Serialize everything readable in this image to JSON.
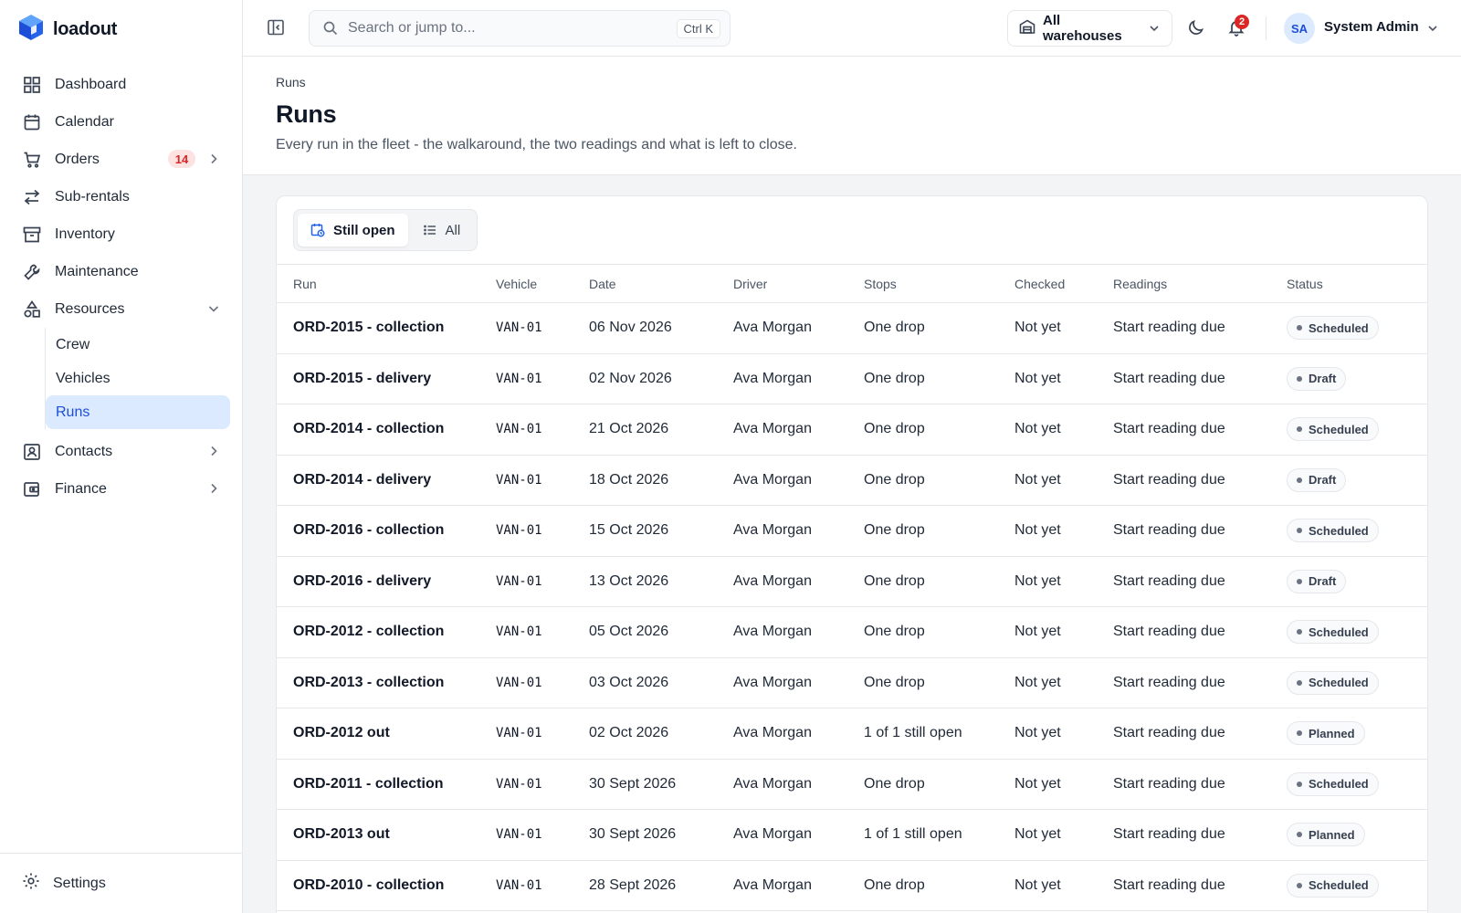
{
  "brand": {
    "name": "loadout"
  },
  "sidebar": {
    "items": [
      {
        "label": "Dashboard",
        "icon": "grid-icon"
      },
      {
        "label": "Calendar",
        "icon": "calendar-icon"
      },
      {
        "label": "Orders",
        "icon": "cart-icon",
        "badge": "14"
      },
      {
        "label": "Sub-rentals",
        "icon": "swap-icon"
      },
      {
        "label": "Inventory",
        "icon": "archive-icon"
      },
      {
        "label": "Maintenance",
        "icon": "wrench-icon"
      },
      {
        "label": "Resources",
        "icon": "shapes-icon"
      },
      {
        "label": "Contacts",
        "icon": "contact-card-icon"
      },
      {
        "label": "Finance",
        "icon": "wallet-icon"
      }
    ],
    "resources_sub": [
      "Crew",
      "Vehicles",
      "Runs"
    ],
    "active_sub": "Runs",
    "settings_label": "Settings"
  },
  "topbar": {
    "search_placeholder": "Search or jump to...",
    "shortcut": "Ctrl K",
    "warehouse": "All warehouses",
    "notifications": "2",
    "avatar_initials": "SA",
    "user_name": "System Admin"
  },
  "page": {
    "breadcrumb": "Runs",
    "title": "Runs",
    "subtitle": "Every run in the fleet - the walkaround, the two readings and what is left to close."
  },
  "filters": {
    "still_open": "Still open",
    "all": "All",
    "selected": "Still open"
  },
  "table": {
    "columns": [
      "Run",
      "Vehicle",
      "Date",
      "Driver",
      "Stops",
      "Checked",
      "Readings",
      "Status"
    ],
    "rows": [
      [
        "ORD-2015 - collection",
        "VAN-01",
        "06 Nov 2026",
        "Ava Morgan",
        "One drop",
        "Not yet",
        "Start reading due",
        "Scheduled"
      ],
      [
        "ORD-2015 - delivery",
        "VAN-01",
        "02 Nov 2026",
        "Ava Morgan",
        "One drop",
        "Not yet",
        "Start reading due",
        "Draft"
      ],
      [
        "ORD-2014 - collection",
        "VAN-01",
        "21 Oct 2026",
        "Ava Morgan",
        "One drop",
        "Not yet",
        "Start reading due",
        "Scheduled"
      ],
      [
        "ORD-2014 - delivery",
        "VAN-01",
        "18 Oct 2026",
        "Ava Morgan",
        "One drop",
        "Not yet",
        "Start reading due",
        "Draft"
      ],
      [
        "ORD-2016 - collection",
        "VAN-01",
        "15 Oct 2026",
        "Ava Morgan",
        "One drop",
        "Not yet",
        "Start reading due",
        "Scheduled"
      ],
      [
        "ORD-2016 - delivery",
        "VAN-01",
        "13 Oct 2026",
        "Ava Morgan",
        "One drop",
        "Not yet",
        "Start reading due",
        "Draft"
      ],
      [
        "ORD-2012 - collection",
        "VAN-01",
        "05 Oct 2026",
        "Ava Morgan",
        "One drop",
        "Not yet",
        "Start reading due",
        "Scheduled"
      ],
      [
        "ORD-2013 - collection",
        "VAN-01",
        "03 Oct 2026",
        "Ava Morgan",
        "One drop",
        "Not yet",
        "Start reading due",
        "Scheduled"
      ],
      [
        "ORD-2012 out",
        "VAN-01",
        "02 Oct 2026",
        "Ava Morgan",
        "1 of 1 still open",
        "Not yet",
        "Start reading due",
        "Planned"
      ],
      [
        "ORD-2011 - collection",
        "VAN-01",
        "30 Sept 2026",
        "Ava Morgan",
        "One drop",
        "Not yet",
        "Start reading due",
        "Scheduled"
      ],
      [
        "ORD-2013 out",
        "VAN-01",
        "30 Sept 2026",
        "Ava Morgan",
        "1 of 1 still open",
        "Not yet",
        "Start reading due",
        "Planned"
      ],
      [
        "ORD-2010 - collection",
        "VAN-01",
        "28 Sept 2026",
        "Ava Morgan",
        "One drop",
        "Not yet",
        "Start reading due",
        "Scheduled"
      ]
    ]
  },
  "colors": {
    "accent": "#1d4ed8",
    "active_bg": "#dbeafe",
    "danger": "#dc2626",
    "brand": "#2563eb"
  }
}
